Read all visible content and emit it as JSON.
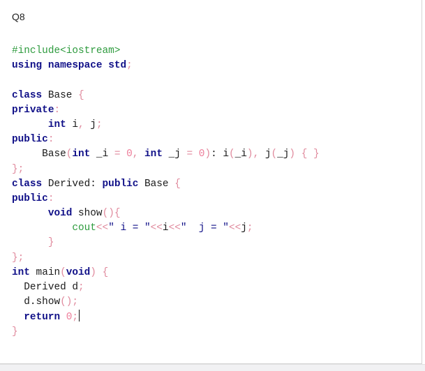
{
  "question": {
    "label": "Q8"
  },
  "code": {
    "lines": [
      [
        {
          "t": "pp",
          "v": "#include<iostream>"
        }
      ],
      [
        {
          "t": "kw",
          "v": "using namespace"
        },
        {
          "t": "pl",
          "v": " "
        },
        {
          "t": "kw",
          "v": "std"
        },
        {
          "t": "op",
          "v": ";"
        }
      ],
      [],
      [
        {
          "t": "kw",
          "v": "class"
        },
        {
          "t": "pl",
          "v": " Base "
        },
        {
          "t": "op",
          "v": "{"
        }
      ],
      [
        {
          "t": "kw",
          "v": "private"
        },
        {
          "t": "op",
          "v": ":"
        }
      ],
      [
        {
          "t": "pl",
          "v": "      "
        },
        {
          "t": "kw",
          "v": "int"
        },
        {
          "t": "pl",
          "v": " i"
        },
        {
          "t": "op",
          "v": ","
        },
        {
          "t": "pl",
          "v": " j"
        },
        {
          "t": "op",
          "v": ";"
        }
      ],
      [
        {
          "t": "kw",
          "v": "public"
        },
        {
          "t": "op",
          "v": ":"
        }
      ],
      [
        {
          "t": "pl",
          "v": "     Base"
        },
        {
          "t": "op",
          "v": "("
        },
        {
          "t": "kw",
          "v": "int"
        },
        {
          "t": "pl",
          "v": " _i "
        },
        {
          "t": "op",
          "v": "="
        },
        {
          "t": "pl",
          "v": " "
        },
        {
          "t": "num",
          "v": "0"
        },
        {
          "t": "op",
          "v": ","
        },
        {
          "t": "pl",
          "v": " "
        },
        {
          "t": "kw",
          "v": "int"
        },
        {
          "t": "pl",
          "v": " _j "
        },
        {
          "t": "op",
          "v": "="
        },
        {
          "t": "pl",
          "v": " "
        },
        {
          "t": "num",
          "v": "0"
        },
        {
          "t": "op",
          "v": ")"
        },
        {
          "t": "pl",
          "v": ": i"
        },
        {
          "t": "op",
          "v": "("
        },
        {
          "t": "pl",
          "v": "_i"
        },
        {
          "t": "op",
          "v": ")"
        },
        {
          "t": "op",
          "v": ","
        },
        {
          "t": "pl",
          "v": " j"
        },
        {
          "t": "op",
          "v": "("
        },
        {
          "t": "pl",
          "v": "_j"
        },
        {
          "t": "op",
          "v": ")"
        },
        {
          "t": "pl",
          "v": " "
        },
        {
          "t": "op",
          "v": "{"
        },
        {
          "t": "pl",
          "v": " "
        },
        {
          "t": "op",
          "v": "}"
        }
      ],
      [
        {
          "t": "op",
          "v": "};"
        }
      ],
      [
        {
          "t": "kw",
          "v": "class"
        },
        {
          "t": "pl",
          "v": " Derived: "
        },
        {
          "t": "kw",
          "v": "public"
        },
        {
          "t": "pl",
          "v": " Base "
        },
        {
          "t": "op",
          "v": "{"
        }
      ],
      [
        {
          "t": "kw",
          "v": "public"
        },
        {
          "t": "op",
          "v": ":"
        }
      ],
      [
        {
          "t": "pl",
          "v": "      "
        },
        {
          "t": "kw",
          "v": "void"
        },
        {
          "t": "pl",
          "v": " show"
        },
        {
          "t": "op",
          "v": "(){"
        }
      ],
      [
        {
          "t": "pl",
          "v": "          "
        },
        {
          "t": "pp",
          "v": "cout"
        },
        {
          "t": "op",
          "v": "<<"
        },
        {
          "t": "str",
          "v": "\" i = \""
        },
        {
          "t": "op",
          "v": "<<"
        },
        {
          "t": "pl",
          "v": "i"
        },
        {
          "t": "op",
          "v": "<<"
        },
        {
          "t": "str",
          "v": "\"  j = \""
        },
        {
          "t": "op",
          "v": "<<"
        },
        {
          "t": "pl",
          "v": "j"
        },
        {
          "t": "op",
          "v": ";"
        }
      ],
      [
        {
          "t": "pl",
          "v": "      "
        },
        {
          "t": "op",
          "v": "}"
        }
      ],
      [
        {
          "t": "op",
          "v": "};"
        }
      ],
      [
        {
          "t": "kw",
          "v": "int"
        },
        {
          "t": "pl",
          "v": " main"
        },
        {
          "t": "op",
          "v": "("
        },
        {
          "t": "kw",
          "v": "void"
        },
        {
          "t": "op",
          "v": ")"
        },
        {
          "t": "pl",
          "v": " "
        },
        {
          "t": "op",
          "v": "{"
        }
      ],
      [
        {
          "t": "pl",
          "v": "  Derived d"
        },
        {
          "t": "op",
          "v": ";"
        }
      ],
      [
        {
          "t": "pl",
          "v": "  d.show"
        },
        {
          "t": "op",
          "v": "();"
        }
      ],
      [
        {
          "t": "pl",
          "v": "  "
        },
        {
          "t": "kw",
          "v": "return"
        },
        {
          "t": "pl",
          "v": " "
        },
        {
          "t": "num",
          "v": "0"
        },
        {
          "t": "op",
          "v": ";"
        }
      ],
      [
        {
          "t": "op",
          "v": "}"
        }
      ]
    ],
    "caret_line": 18
  }
}
